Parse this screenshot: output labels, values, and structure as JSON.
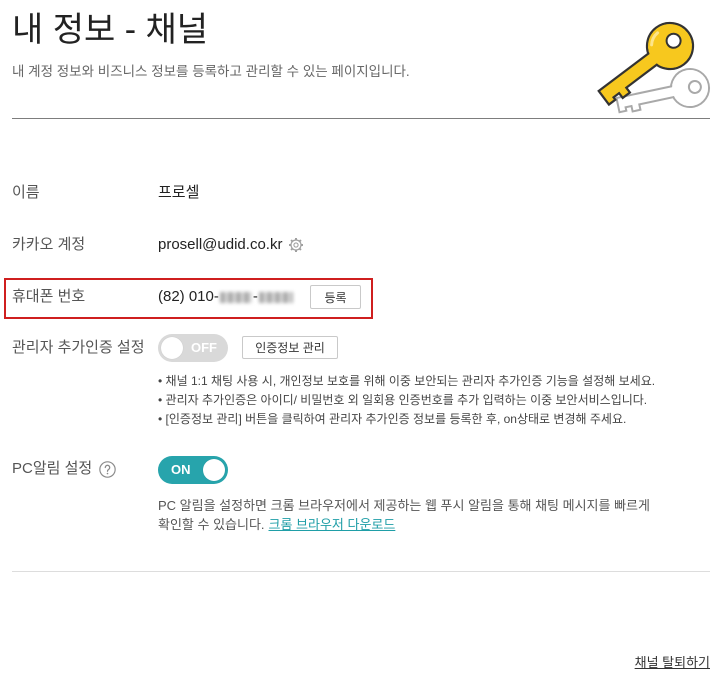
{
  "header": {
    "title": "내 정보 - 채널",
    "subtitle": "내 계정 정보와 비즈니스 정보를 등록하고 관리할 수 있는 페이지입니다.",
    "illustration_icon": "key-icon"
  },
  "fields": {
    "name": {
      "label": "이름",
      "value": "프로셀"
    },
    "kakao_account": {
      "label": "카카오 계정",
      "value": "prosell@udid.co.kr",
      "settings_icon": "gear-icon"
    },
    "phone": {
      "label": "휴대폰 번호",
      "prefix": "(82) 010-",
      "separator": "-",
      "register_button": "등록"
    },
    "admin_auth": {
      "label": "관리자 추가인증 설정",
      "toggle_label": "OFF",
      "toggle_enabled": false,
      "manage_button": "인증정보 관리",
      "notes": [
        "• 채널 1:1 채팅 사용 시, 개인정보 보호를 위해 이중 보안되는 관리자 추가인증 기능을 설정해 보세요.",
        "• 관리자 추가인증은 아이디/ 비밀번호 외 일회용 인증번호를 추가 입력하는 이중 보안서비스입니다.",
        "• [인증정보 관리] 버튼을 클릭하여 관리자 추가인증 정보를 등록한 후, on상태로 변경해 주세요."
      ]
    },
    "pc_alarm": {
      "label": "PC알림 설정",
      "help_icon": "question-circle-icon",
      "toggle_label": "ON",
      "toggle_enabled": true,
      "description_lines": [
        "PC 알림을 설정하면 크롬 브라우저에서 제공하는 웹 푸시 알림을 통해 채팅 메시지를 빠르게",
        "확인할 수 있습니다."
      ],
      "download_link": "크롬 브라우저 다운로드"
    }
  },
  "footer": {
    "withdraw_link": "채널 탈퇴하기"
  },
  "colors": {
    "accent": "#27a4ac",
    "link": "#1f9ea7",
    "highlight": "#cf1f1f",
    "toggle_off": "#d9d9d9",
    "key_yellow": "#f7c81e",
    "text": "#222222",
    "label": "#555555"
  }
}
